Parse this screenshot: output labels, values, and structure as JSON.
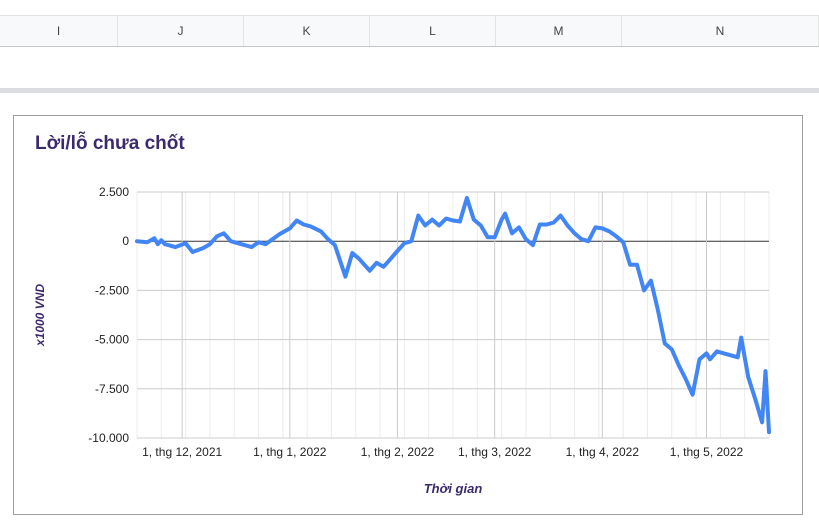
{
  "columns": [
    "I",
    "J",
    "K",
    "L",
    "M",
    "N"
  ],
  "chart_data": {
    "type": "line",
    "title": "Lời/lỗ chưa chốt",
    "xlabel": "Thời gian",
    "ylabel": "x1000 VND",
    "x_ticks": [
      "1, thg 12, 2021",
      "1, thg 1, 2022",
      "1, thg 2, 2022",
      "1, thg 3, 2022",
      "1, thg 4, 2022",
      "1, thg 5, 2022"
    ],
    "y_ticks": [
      "2.500",
      "0",
      "-2.500",
      "-5.000",
      "-7.500",
      "-10.000"
    ],
    "ylim": [
      -10000,
      2500
    ],
    "xlim": [
      "2021-11-18",
      "2022-05-19"
    ],
    "grid": true,
    "color": "#4285f4",
    "series": [
      {
        "x": [
          "2021-11-18",
          "2021-11-21",
          "2021-11-23",
          "2021-11-24",
          "2021-11-25",
          "2021-11-26",
          "2021-11-27",
          "2021-11-29",
          "2021-12-02",
          "2021-12-04",
          "2021-12-07",
          "2021-12-09",
          "2021-12-11",
          "2021-12-13",
          "2021-12-15",
          "2021-12-17",
          "2021-12-19",
          "2021-12-21",
          "2021-12-23",
          "2021-12-25",
          "2021-12-29",
          "2022-01-01",
          "2022-01-03",
          "2022-01-05",
          "2022-01-07",
          "2022-01-10",
          "2022-01-12",
          "2022-01-14",
          "2022-01-17",
          "2022-01-19",
          "2022-01-21",
          "2022-01-24",
          "2022-01-26",
          "2022-01-28",
          "2022-01-30",
          "2022-02-01",
          "2022-02-03",
          "2022-02-05",
          "2022-02-07",
          "2022-02-09",
          "2022-02-11",
          "2022-02-13",
          "2022-02-15",
          "2022-02-17",
          "2022-02-19",
          "2022-02-21",
          "2022-02-23",
          "2022-02-25",
          "2022-02-27",
          "2022-03-01",
          "2022-03-03",
          "2022-03-04",
          "2022-03-06",
          "2022-03-08",
          "2022-03-10",
          "2022-03-12",
          "2022-03-14",
          "2022-03-16",
          "2022-03-18",
          "2022-03-20",
          "2022-03-22",
          "2022-03-24",
          "2022-03-26",
          "2022-03-28",
          "2022-03-30",
          "2022-04-01",
          "2022-04-03",
          "2022-04-05",
          "2022-04-07",
          "2022-04-09",
          "2022-04-11",
          "2022-04-13",
          "2022-04-15",
          "2022-04-17",
          "2022-04-19",
          "2022-04-21",
          "2022-04-23",
          "2022-04-25",
          "2022-04-27",
          "2022-04-29",
          "2022-05-01",
          "2022-05-02",
          "2022-05-04",
          "2022-05-06",
          "2022-05-08",
          "2022-05-10",
          "2022-05-11",
          "2022-05-13",
          "2022-05-15",
          "2022-05-17",
          "2022-05-18",
          "2022-05-19"
        ],
        "y": [
          0,
          -50,
          150,
          -150,
          50,
          -150,
          -200,
          -300,
          -100,
          -550,
          -350,
          -150,
          250,
          400,
          0,
          -100,
          -200,
          -300,
          -50,
          -150,
          350,
          650,
          1050,
          850,
          750,
          500,
          100,
          -200,
          -1800,
          -600,
          -900,
          -1500,
          -1100,
          -1300,
          -900,
          -500,
          -100,
          0,
          1300,
          800,
          1100,
          800,
          1150,
          1050,
          1000,
          2200,
          1100,
          800,
          200,
          200,
          1100,
          1400,
          400,
          700,
          100,
          -200,
          850,
          850,
          950,
          1300,
          800,
          400,
          100,
          0,
          700,
          650,
          500,
          250,
          -50,
          -1200,
          -1200,
          -2500,
          -2000,
          -3500,
          -5200,
          -5500,
          -6300,
          -7000,
          -7800,
          -6000,
          -5700,
          -6000,
          -5600,
          -5700,
          -5800,
          -5900,
          -4900,
          -6900,
          -8000,
          -9200,
          -6600,
          -9700
        ]
      }
    ]
  }
}
